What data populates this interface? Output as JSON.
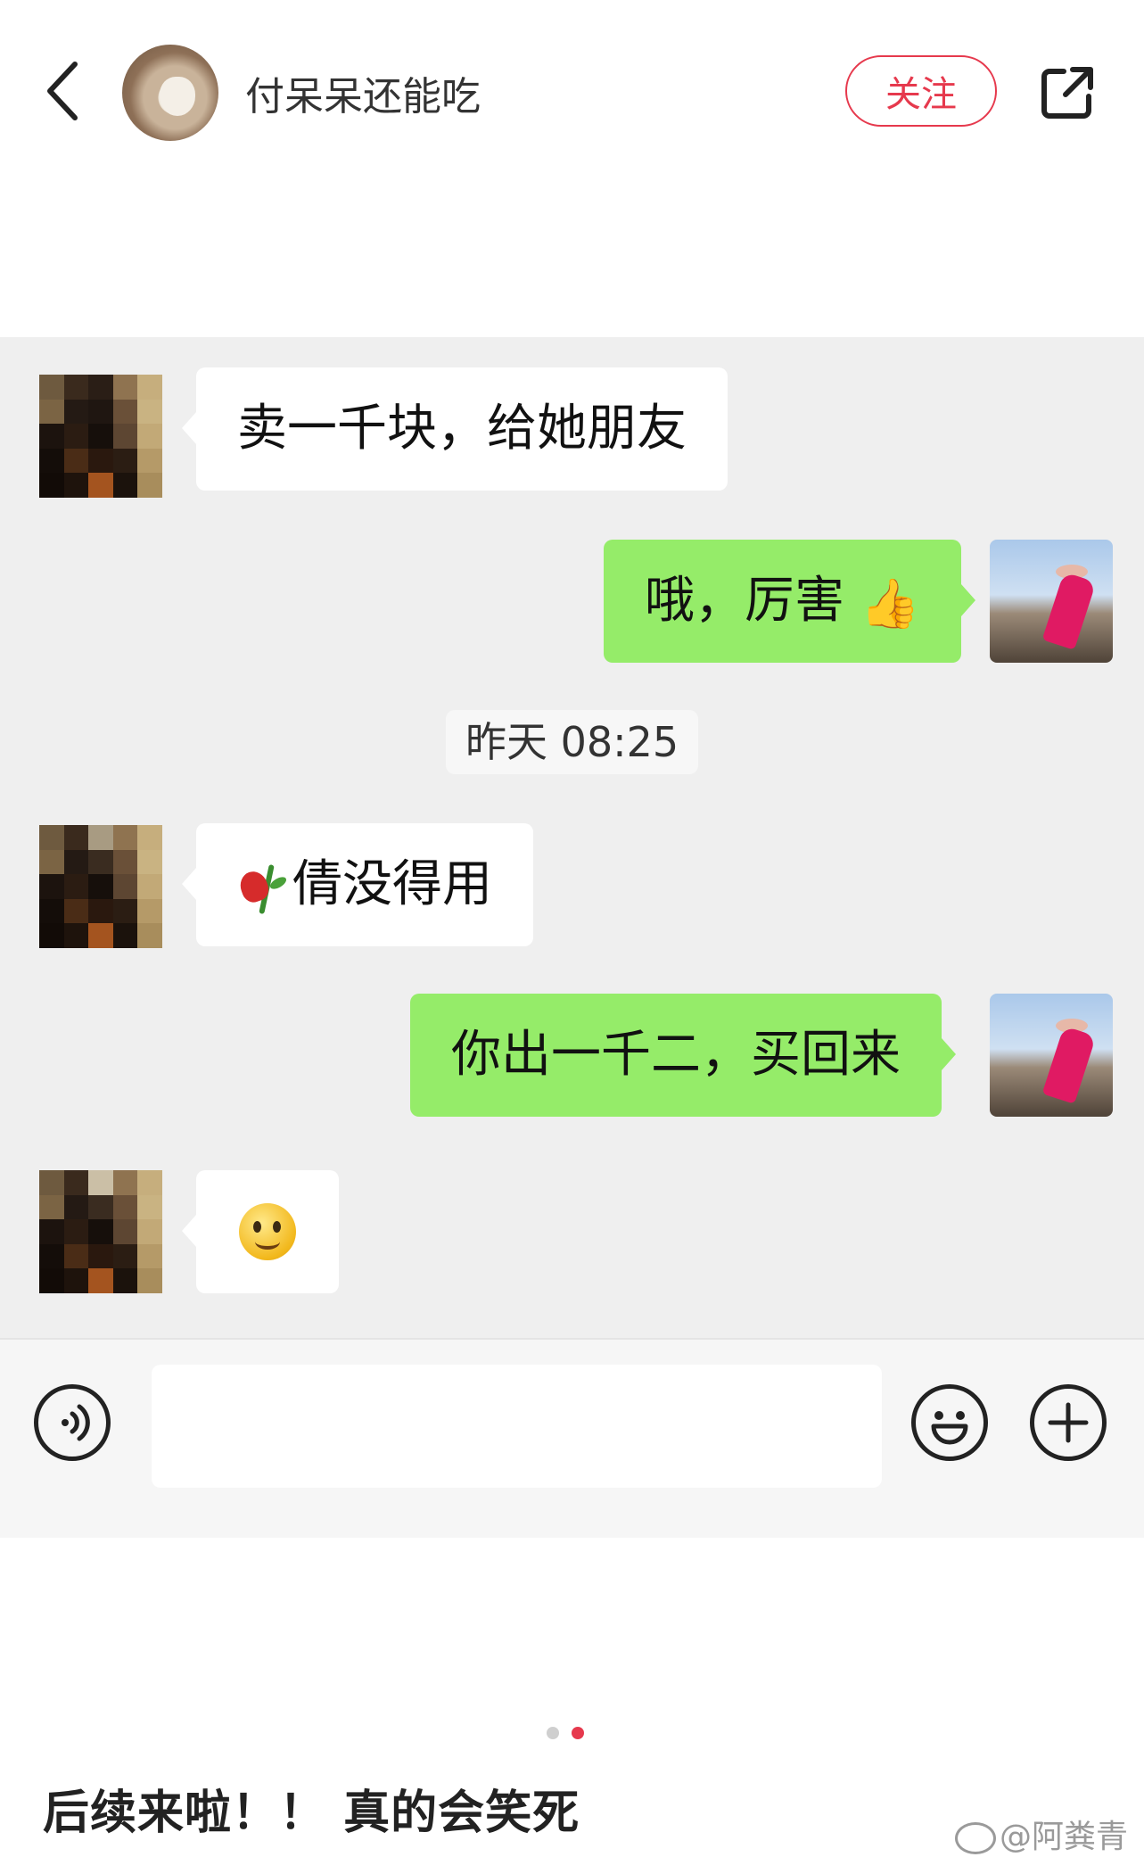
{
  "header": {
    "author_name": "付呆呆还能吃",
    "follow_label": "关注"
  },
  "chat": {
    "messages": [
      {
        "side": "left",
        "text": "卖一千块，给她朋友"
      },
      {
        "side": "right",
        "text": "哦，厉害",
        "emoji": "thumbs-up"
      },
      {
        "side": "left",
        "text": "倩没得用",
        "emoji": "wilted-rose"
      },
      {
        "side": "right",
        "text": "你出一千二，买回来"
      },
      {
        "side": "left",
        "text": "",
        "emoji": "smiley"
      }
    ],
    "timestamp": "昨天 08:25",
    "input_placeholder": ""
  },
  "pagination": {
    "current": 2,
    "total": 2
  },
  "post": {
    "text": "后续来啦！！ 真的会笑死"
  },
  "watermark": "@阿粪青",
  "colors": {
    "accent": "#e6394d",
    "bubble_green": "#95ec69",
    "chat_bg": "#efefef"
  },
  "icons": [
    "back-arrow-icon",
    "share-icon",
    "voice-icon",
    "emoji-icon",
    "plus-icon",
    "weibo-icon"
  ]
}
